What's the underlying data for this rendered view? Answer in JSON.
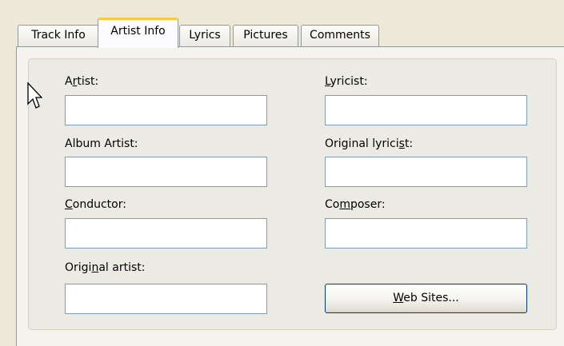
{
  "tabs": [
    {
      "label": "Track Info",
      "active": false
    },
    {
      "label": "Artist Info",
      "active": true
    },
    {
      "label": "Lyrics",
      "active": false
    },
    {
      "label": "Pictures",
      "active": false
    },
    {
      "label": "Comments",
      "active": false
    }
  ],
  "form": {
    "artist": {
      "pre": "A",
      "key": "r",
      "post": "tist:",
      "value": ""
    },
    "album_artist": {
      "label": "Album Artist:",
      "value": ""
    },
    "conductor": {
      "pre": "",
      "key": "C",
      "post": "onductor:",
      "value": ""
    },
    "original_artist": {
      "pre": "Origi",
      "key": "n",
      "post": "al artist:",
      "value": ""
    },
    "lyricist": {
      "pre": "",
      "key": "L",
      "post": "yricist:",
      "value": ""
    },
    "original_lyricist": {
      "pre": "Original lyrici",
      "key": "s",
      "post": "t:",
      "value": ""
    },
    "composer": {
      "pre": "Co",
      "key": "m",
      "post": "poser:",
      "value": ""
    },
    "web_sites_button": {
      "pre": "",
      "key": "W",
      "post": "eb Sites..."
    }
  },
  "colors": {
    "window_bg": "#ece9d8",
    "tab_highlight": "#ffc83c",
    "field_border": "#7f9db9",
    "button_border": "#003c74"
  },
  "cursor_icon": "mouse-pointer-icon"
}
